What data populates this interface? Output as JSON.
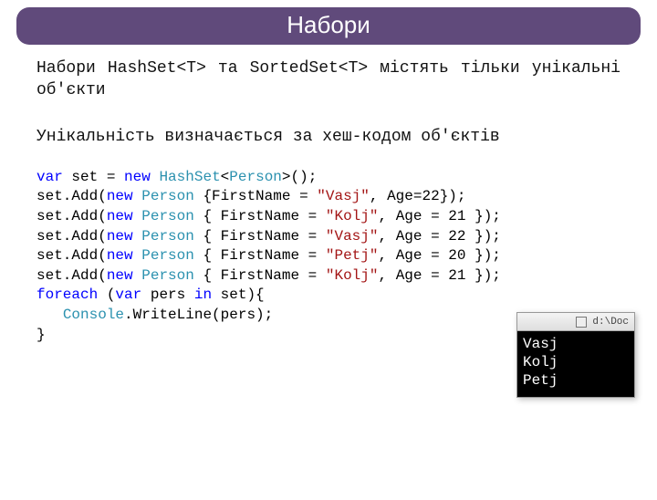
{
  "title": "Набори",
  "paragraphs": {
    "p1": "Набори HashSet<T> та SortedSet<T> містять тільки унікальні об'єкти",
    "p2": "Унікальність визначається за хеш-кодом об'єктів"
  },
  "code": {
    "lines": [
      {
        "kind": "decl",
        "prefix": "var",
        "mid": " set = ",
        "kw2": "new",
        "sp": " ",
        "typ": "HashSet",
        "g1": "<",
        "typ2": "Person",
        "g2": ">",
        "tail": "();"
      },
      {
        "kind": "add",
        "pre": "set.Add(",
        "kw": "new",
        "sp": " ",
        "typ": "Person",
        "body1": " {FirstName = ",
        "str": "\"Vasj\"",
        "body2": ", Age=22});"
      },
      {
        "kind": "add",
        "pre": "set.Add(",
        "kw": "new",
        "sp": " ",
        "typ": "Person",
        "body1": " { FirstName = ",
        "str": "\"Kolj\"",
        "body2": ", Age = 21 });"
      },
      {
        "kind": "add",
        "pre": "set.Add(",
        "kw": "new",
        "sp": " ",
        "typ": "Person",
        "body1": " { FirstName = ",
        "str": "\"Vasj\"",
        "body2": ", Age = 22 });"
      },
      {
        "kind": "add",
        "pre": "set.Add(",
        "kw": "new",
        "sp": " ",
        "typ": "Person",
        "body1": " { FirstName = ",
        "str": "\"Petj\"",
        "body2": ", Age = 20 });"
      },
      {
        "kind": "add",
        "pre": "set.Add(",
        "kw": "new",
        "sp": " ",
        "typ": "Person",
        "body1": " { FirstName = ",
        "str": "\"Kolj\"",
        "body2": ", Age = 21 });"
      },
      {
        "kind": "foreach",
        "kw1": "foreach",
        "t1": " (",
        "kw2": "var",
        "t2": " pers ",
        "kw3": "in",
        "t3": " set){"
      },
      {
        "kind": "call",
        "indent": "   ",
        "typ": "Console",
        "tail": ".WriteLine(pers);"
      },
      {
        "kind": "plain",
        "text": "}"
      }
    ]
  },
  "console": {
    "titlebar_text": "d:\\Doc",
    "lines": [
      "Vasj",
      "Kolj",
      "Petj"
    ]
  }
}
